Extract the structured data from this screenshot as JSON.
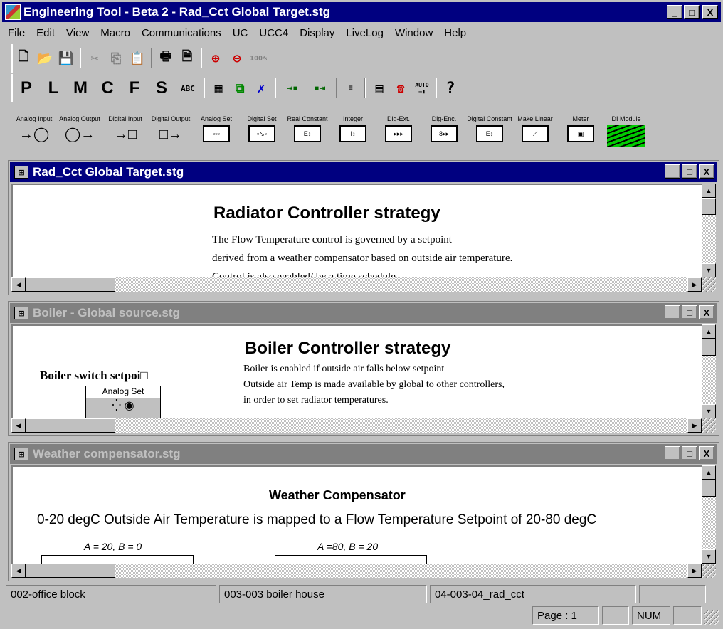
{
  "app": {
    "title": "Engineering Tool - Beta 2 - Rad_Cct Global Target.stg",
    "caption_buttons": [
      "_",
      "□",
      "X"
    ]
  },
  "menu": [
    "File",
    "Edit",
    "View",
    "Macro",
    "Communications",
    "UC",
    "UCC4",
    "Display",
    "LiveLog",
    "Window",
    "Help"
  ],
  "toolbar1": {
    "icons": [
      "new-icon",
      "open-icon",
      "save-icon",
      "cut-icon",
      "copy-icon",
      "paste-icon",
      "print-icon",
      "print-preview-icon",
      "zoom-in-icon",
      "zoom-out-icon",
      "zoom-100-icon"
    ],
    "zoom_label": "100%"
  },
  "toolbar2": {
    "letters": [
      "P",
      "L",
      "M",
      "C",
      "F",
      "S"
    ],
    "abc": "ABC",
    "auto": "AUTO",
    "help": "?"
  },
  "palette": [
    {
      "label": "Analog Input",
      "sym": "→◯"
    },
    {
      "label": "Analog Output",
      "sym": "◯→"
    },
    {
      "label": "Digital Input",
      "sym": "→□"
    },
    {
      "label": "Digital Output",
      "sym": "□→"
    },
    {
      "label": "Analog Set",
      "sym": "▫▫▫"
    },
    {
      "label": "Digital Set",
      "sym": "▫↘▫"
    },
    {
      "label": "Real Constant",
      "sym": "E↕"
    },
    {
      "label": "Integer",
      "sym": "I↕"
    },
    {
      "label": "Dig-Ext.",
      "sym": "▸▸▸"
    },
    {
      "label": "Dig-Enc.",
      "sym": "8▸▸"
    },
    {
      "label": "Digital Constant",
      "sym": "E↕"
    },
    {
      "label": "Make Linear",
      "sym": "⟋"
    },
    {
      "label": "Meter",
      "sym": "▣"
    },
    {
      "label": "DI Module",
      "sym": ""
    }
  ],
  "windows": {
    "rad": {
      "title": "Rad_Cct Global Target.stg",
      "heading": "Radiator Controller strategy",
      "lines": [
        "The Flow Temperature control is governed by a setpoint",
        "derived from a weather compensator based on outside air temperature.",
        "Control is also enabled/ by a time schedule"
      ]
    },
    "boiler": {
      "title": "Boiler - Global source.stg",
      "heading": "Boiler Controller strategy",
      "lines": [
        "Boiler is enabled if outside air falls below setpoint",
        "Outside air Temp is made available by global to other controllers,",
        "in order to set radiator temperatures."
      ],
      "block_title": "Boiler switch setpoi□",
      "block_label": "Analog Set"
    },
    "weather": {
      "title": "Weather compensator.stg",
      "heading": "Weather Compensator",
      "subtitle": "0-20 degC Outside Air Temperature is mapped to a Flow Temperature Setpoint of 20-80 degC",
      "formula1": "A = 20, B = 0",
      "formula2": "A =80, B = 20"
    }
  },
  "status": {
    "pane1": "002-office block",
    "pane2": "003-003 boiler house",
    "pane3": "04-003-04_rad_cct",
    "page": "Page : 1",
    "num": "NUM"
  }
}
